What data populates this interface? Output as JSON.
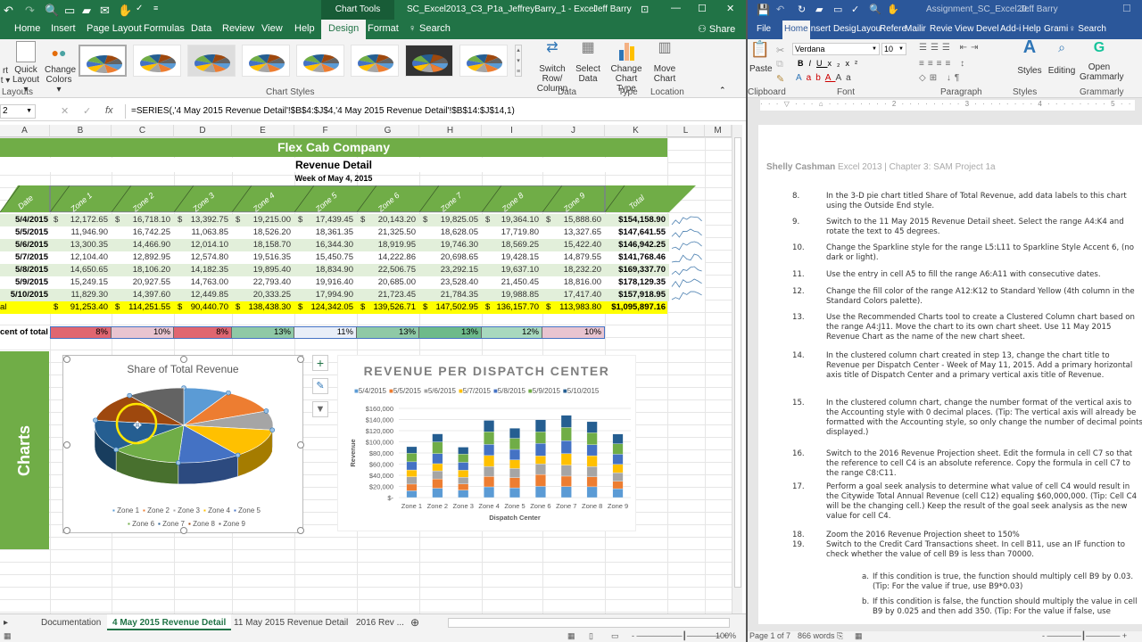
{
  "excel": {
    "window_title": "SC_Excel2013_C3_P1a_JeffreyBarry_1  -  Excel",
    "context_tab_group": "Chart Tools",
    "user": "Jeff Barry",
    "ribbon_tabs": [
      "Home",
      "Insert",
      "Page Layout",
      "Formulas",
      "Data",
      "Review",
      "View",
      "Help",
      "Design",
      "Format"
    ],
    "active_tab": "Design",
    "search_label": "Search",
    "share_label": "Share",
    "ribbon": {
      "add_chart_element": "rt",
      "add_chart_element_sub": "t",
      "quick_layout": "Quick",
      "quick_layout_sub": "Layout",
      "change_colors": "Change",
      "change_colors_sub": "Colors",
      "chart_layouts_group": "Layouts",
      "chart_styles_group": "Chart Styles",
      "switch_row_col": "Switch Row/",
      "switch_row_col_sub": "Column",
      "select_data": "Select",
      "select_data_sub": "Data",
      "data_group": "Data",
      "change_chart_type": "Change",
      "change_chart_type_sub": "Chart Type",
      "type_group": "Type",
      "move_chart": "Move",
      "move_chart_sub": "Chart",
      "location_group": "Location"
    },
    "name_box": "2",
    "formula": "=SERIES(,'4 May 2015 Revenue Detail'!$B$4:$J$4,'4 May 2015 Revenue Detail'!$B$14:$J$14,1)",
    "columns": [
      "A",
      "B",
      "C",
      "D",
      "E",
      "F",
      "G",
      "H",
      "I",
      "J",
      "K",
      "L",
      "M"
    ],
    "sheet": {
      "company": "Flex Cab Company",
      "subtitle": "Revenue Detail",
      "week": "Week of May 4, 2015",
      "headers": [
        "Date",
        "Zone 1",
        "Zone 2",
        "Zone 3",
        "Zone 4",
        "Zone 5",
        "Zone 6",
        "Zone 7",
        "Zone 8",
        "Zone 9",
        "Total"
      ],
      "rows": [
        {
          "date": "5/4/2015",
          "values": [
            "12,172.65",
            "16,718.10",
            "13,392.75",
            "19,215.00",
            "17,439.45",
            "20,143.20",
            "19,825.05",
            "19,364.10",
            "15,888.60"
          ],
          "total": "$154,158.90"
        },
        {
          "date": "5/5/2015",
          "values": [
            "11,946.90",
            "16,742.25",
            "11,063.85",
            "18,526.20",
            "18,361.35",
            "21,325.50",
            "18,628.05",
            "17,719.80",
            "13,327.65"
          ],
          "total": "$147,641.55"
        },
        {
          "date": "5/6/2015",
          "values": [
            "13,300.35",
            "14,466.90",
            "12,014.10",
            "18,158.70",
            "16,344.30",
            "18,919.95",
            "19,746.30",
            "18,569.25",
            "15,422.40"
          ],
          "total": "$146,942.25"
        },
        {
          "date": "5/7/2015",
          "values": [
            "12,104.40",
            "12,892.95",
            "12,574.80",
            "19,516.35",
            "15,450.75",
            "14,222.86",
            "20,698.65",
            "19,428.15",
            "14,879.55"
          ],
          "total": "$141,768.46"
        },
        {
          "date": "5/8/2015",
          "values": [
            "14,650.65",
            "18,106.20",
            "14,182.35",
            "19,895.40",
            "18,834.90",
            "22,506.75",
            "23,292.15",
            "19,637.10",
            "18,232.20"
          ],
          "total": "$169,337.70"
        },
        {
          "date": "5/9/2015",
          "values": [
            "15,249.15",
            "20,927.55",
            "14,763.00",
            "22,793.40",
            "19,916.40",
            "20,685.00",
            "23,528.40",
            "21,450.45",
            "18,816.00"
          ],
          "total": "$178,129.35"
        },
        {
          "date": "5/10/2015",
          "values": [
            "11,829.30",
            "14,397.60",
            "12,449.85",
            "20,333.25",
            "17,994.90",
            "21,723.45",
            "21,784.35",
            "19,988.85",
            "17,417.40"
          ],
          "total": "$157,918.95"
        }
      ],
      "total_label": "al",
      "totals": [
        "91,253.40",
        "114,251.55",
        "90,440.70",
        "138,438.30",
        "124,342.05",
        "139,526.71",
        "147,502.95",
        "136,157.70",
        "113,983.80"
      ],
      "grand_total": "$1,095,897.16",
      "percent_label": "cent of total",
      "percents": [
        "8%",
        "10%",
        "8%",
        "13%",
        "11%",
        "13%",
        "13%",
        "12%",
        "10%"
      ],
      "percent_colors": [
        "#e06670",
        "#e8c4d0",
        "#e06670",
        "#8fc9a6",
        "#e8eef8",
        "#8fc9a6",
        "#6dba8a",
        "#a8d8be",
        "#e8c4d0"
      ],
      "charts_label": "Charts"
    },
    "sheet_tabs": [
      "Documentation",
      "4 May 2015 Revenue Detail",
      "11 May 2015 Revenue Detail",
      "2016 Rev ..."
    ],
    "active_sheet": "4 May 2015 Revenue Detail",
    "zoom": "100%"
  },
  "chart_data": [
    {
      "type": "pie",
      "title": "Share of Total Revenue",
      "categories": [
        "Zone 1",
        "Zone 2",
        "Zone 3",
        "Zone 4",
        "Zone 5",
        "Zone 6",
        "Zone 7",
        "Zone 8",
        "Zone 9"
      ],
      "values": [
        91253.4,
        114251.55,
        90440.7,
        138438.3,
        124342.05,
        139526.71,
        147502.95,
        136157.7,
        113983.8
      ],
      "colors": [
        "#5b9bd5",
        "#ed7d31",
        "#a5a5a5",
        "#ffc000",
        "#4472c4",
        "#70ad47",
        "#255e91",
        "#9e480e",
        "#636363"
      ],
      "legend": "bottom"
    },
    {
      "type": "bar",
      "stacked": true,
      "title": "REVENUE PER DISPATCH CENTER",
      "xlabel": "Dispatch Center",
      "ylabel": "Revenue",
      "ylim": [
        0,
        160000
      ],
      "yticks": [
        "$-",
        "$20,000",
        "$40,000",
        "$60,000",
        "$80,000",
        "$100,000",
        "$120,000",
        "$140,000",
        "$160,000"
      ],
      "categories": [
        "Zone 1",
        "Zone 2",
        "Zone 3",
        "Zone 4",
        "Zone 5",
        "Zone 6",
        "Zone 7",
        "Zone 8",
        "Zone 9"
      ],
      "legend": "top",
      "series": [
        {
          "name": "5/4/2015",
          "color": "#5b9bd5",
          "values": [
            12172.65,
            16718.1,
            13392.75,
            19215.0,
            17439.45,
            20143.2,
            19825.05,
            19364.1,
            15888.6
          ]
        },
        {
          "name": "5/5/2015",
          "color": "#ed7d31",
          "values": [
            11946.9,
            16742.25,
            11063.85,
            18526.2,
            18361.35,
            21325.5,
            18628.05,
            17719.8,
            13327.65
          ]
        },
        {
          "name": "5/6/2015",
          "color": "#a5a5a5",
          "values": [
            13300.35,
            14466.9,
            12014.1,
            18158.7,
            16344.3,
            18919.95,
            19746.3,
            18569.25,
            15422.4
          ]
        },
        {
          "name": "5/7/2015",
          "color": "#ffc000",
          "values": [
            12104.4,
            12892.95,
            12574.8,
            19516.35,
            15450.75,
            14222.86,
            20698.65,
            19428.15,
            14879.55
          ]
        },
        {
          "name": "5/8/2015",
          "color": "#4472c4",
          "values": [
            14650.65,
            18106.2,
            14182.35,
            19895.4,
            18834.9,
            22506.75,
            23292.15,
            19637.1,
            18232.2
          ]
        },
        {
          "name": "5/9/2015",
          "color": "#70ad47",
          "values": [
            15249.15,
            20927.55,
            14763.0,
            22793.4,
            19916.4,
            20685.0,
            23528.4,
            21450.45,
            18816.0
          ]
        },
        {
          "name": "5/10/2015",
          "color": "#255e91",
          "values": [
            11829.3,
            14397.6,
            12449.85,
            20333.25,
            17994.9,
            21723.45,
            21784.35,
            19988.85,
            17417.4
          ]
        }
      ]
    }
  ],
  "word": {
    "window_title": "Assignment_SC_Excel20...",
    "user": "Jeff Barry",
    "tabs": [
      "File",
      "Home",
      "Insert",
      "Desig",
      "Layou",
      "Refere",
      "Mailir",
      "Revie",
      "View",
      "Devel",
      "Add-i",
      "Help",
      "Grami"
    ],
    "active_tab": "Home",
    "search_label": "Search",
    "font_name": "Verdana",
    "font_size": "10",
    "groups": [
      "Clipboard",
      "Font",
      "Paragraph",
      "Styles",
      "Grammarly"
    ],
    "paste_label": "Paste",
    "styles_label": "Styles",
    "editing_label": "Editing",
    "grammarly_label": "Open",
    "grammarly_label_sub": "Grammarly",
    "doc_header_bold": "Shelly Cashman",
    "doc_header_rest": " Excel 2013 |  Chapter 3: SAM Project 1a",
    "steps": [
      {
        "n": "8.",
        "text": "In the 3-D pie chart titled Share of Total Revenue, add data labels to this chart using the Outside End style."
      },
      {
        "n": "9.",
        "text": "Switch to the 11 May 2015 Revenue Detail sheet. Select the range A4:K4 and rotate the text to 45 degrees."
      },
      {
        "n": "10.",
        "text": "Change the Sparkline style for the range L5:L11 to Sparkline Style Accent 6, (no dark or light)."
      },
      {
        "n": "11.",
        "text": "Use the entry in cell A5 to fill the range A6:A11 with consecutive dates."
      },
      {
        "n": "12.",
        "text": "Change the fill color of the range A12:K12 to Standard Yellow (4th column in the Standard Colors palette)."
      },
      {
        "n": "13.",
        "text": "Use the Recommended Charts tool to create a Clustered Column chart based on the range A4:J11. Move the chart to its own chart sheet.  Use 11 May 2015 Revenue Chart as the name of the new chart sheet."
      },
      {
        "n": "14.",
        "text": "In the clustered column chart created in step 13, change the chart title to Revenue per Dispatch Center - Week of May 11, 2015. Add a primary horizontal axis title of Dispatch Center and a primary vertical axis title of Revenue."
      },
      {
        "n": "15.",
        "text": "In the clustered column chart, change the number format of the vertical axis to the Accounting style with 0 decimal places. (Tip: The vertical axis will already be formatted with the Accounting style, so only change the number of decimal points displayed.)"
      },
      {
        "n": "16.",
        "text": "Switch to the 2016 Revenue Projection sheet. Edit the formula in cell C7 so that the reference to cell C4 is an absolute reference. Copy the formula in cell C7 to the range C8:C11."
      },
      {
        "n": "17.",
        "text": "Perform a goal seek analysis to determine what value of cell C4 would result in the Citywide Total Annual Revenue (cell C12) equaling $60,000,000. (Tip: Cell C4 will be the changing cell.) Keep the result of the goal seek analysis as the new value for cell C4."
      },
      {
        "n": "18.",
        "text": "Zoom the 2016 Revenue Projection sheet to 150%"
      },
      {
        "n": "19.",
        "text": "Switch to the Credit Card Transactions sheet. In cell B11, use an IF function to check whether the value of cell B9 is less than 70000."
      },
      {
        "n": "a.",
        "text": "If this condition is true, the function should multiply cell B9 by 0.03. (Tip: For the value if true, use B9*0.03)"
      },
      {
        "n": "b.",
        "text": "If this condition is false, the function should multiply the value in cell B9 by 0.025 and then add 350. (Tip: For the value if false, use"
      }
    ],
    "status_page": "Page 1 of 7",
    "status_words": "866 words"
  }
}
